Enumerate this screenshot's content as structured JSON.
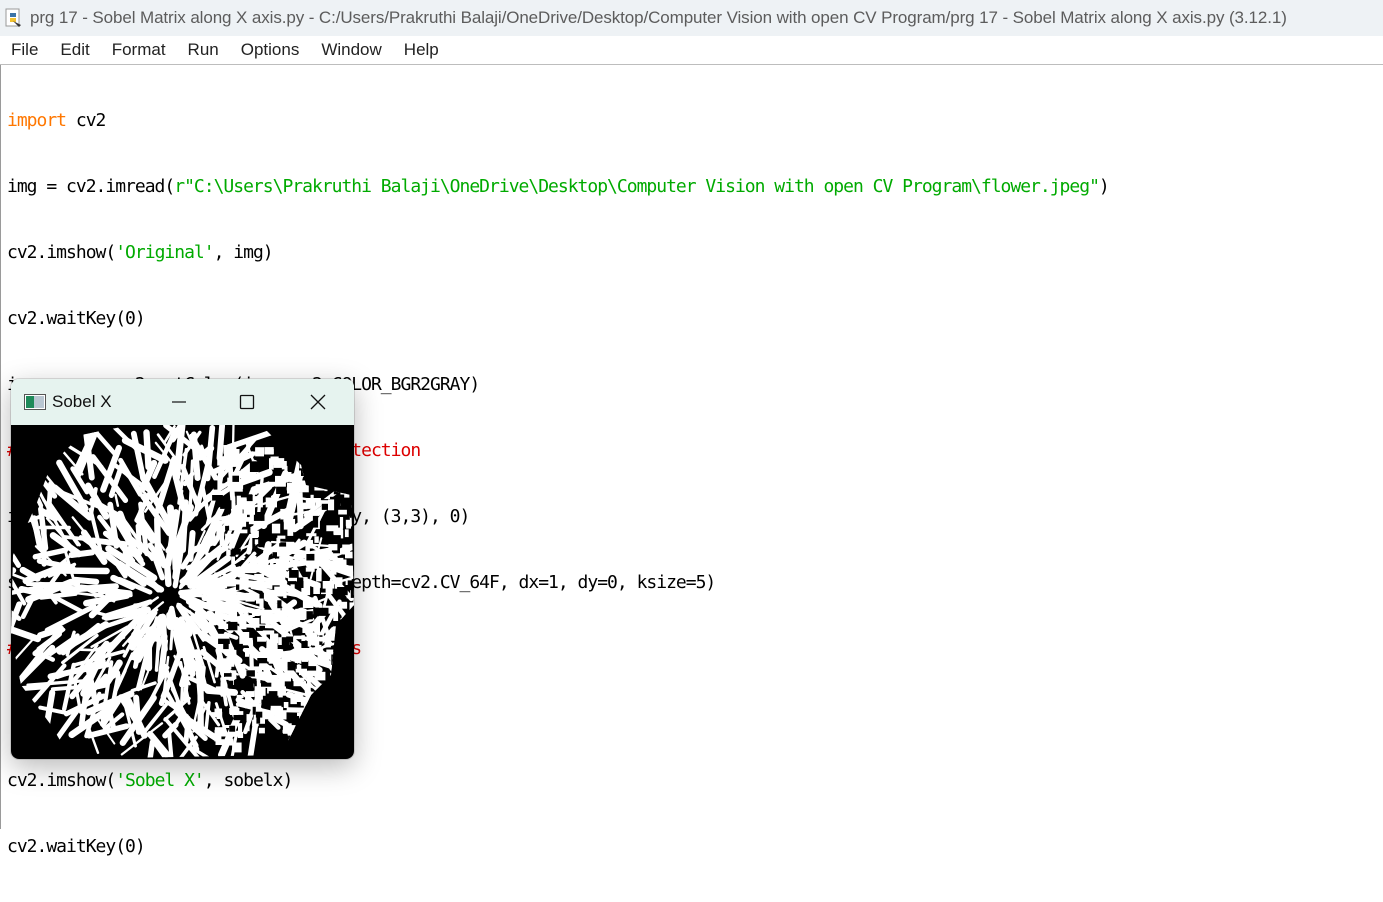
{
  "window": {
    "title": "prg 17 -  Sobel Matrix along X axis.py - C:/Users/Prakruthi Balaji/OneDrive/Desktop/Computer Vision with open CV Program/prg 17 -  Sobel Matrix along X axis.py (3.12.1)",
    "icon": "python-idle-icon"
  },
  "menu": [
    "File",
    "Edit",
    "Format",
    "Run",
    "Options",
    "Window",
    "Help"
  ],
  "code": {
    "l1_kw": "import",
    "l1_rest": " cv2",
    "l2_a": "img = cv2.imread(",
    "l2_str": "r\"C:\\Users\\Prakruthi Balaji\\OneDrive\\Desktop\\Computer Vision with open CV Program\\flower.jpeg\"",
    "l2_b": ")",
    "l3_a": "cv2.imshow(",
    "l3_str": "'Original'",
    "l3_b": ", img)",
    "l4": "cv2.waitKey(0)",
    "l5": "img_gray = cv2.cvtColor(img, cv2.COLOR_BGR2GRAY)",
    "l6": "# Blur the image for better edge detection",
    "l7": "img_blur = cv2.GaussianBlur(img_gray, (3,3), 0)",
    "l8": "sobelx = cv2.Sobel(src=img_blur, ddepth=cv2.CV_64F, dx=1, dy=0, ksize=5)",
    "l9": "# Sobel Edge Detection on the X axis",
    "l10": "",
    "l11_a": "cv2.imshow(",
    "l11_str": "'Sobel X'",
    "l11_b": ", sobelx)",
    "l12": "cv2.waitKey(0)"
  },
  "syntax_colors": {
    "keyword": "#ff7700",
    "string": "#00aa00",
    "comment": "#dd0000"
  },
  "cv_window": {
    "title": "Sobel X",
    "icons": [
      "app-window-icon",
      "minimize-icon",
      "maximize-icon",
      "close-icon"
    ],
    "image": "Sobel X edge-detection output of a flower (white edges on black)"
  }
}
